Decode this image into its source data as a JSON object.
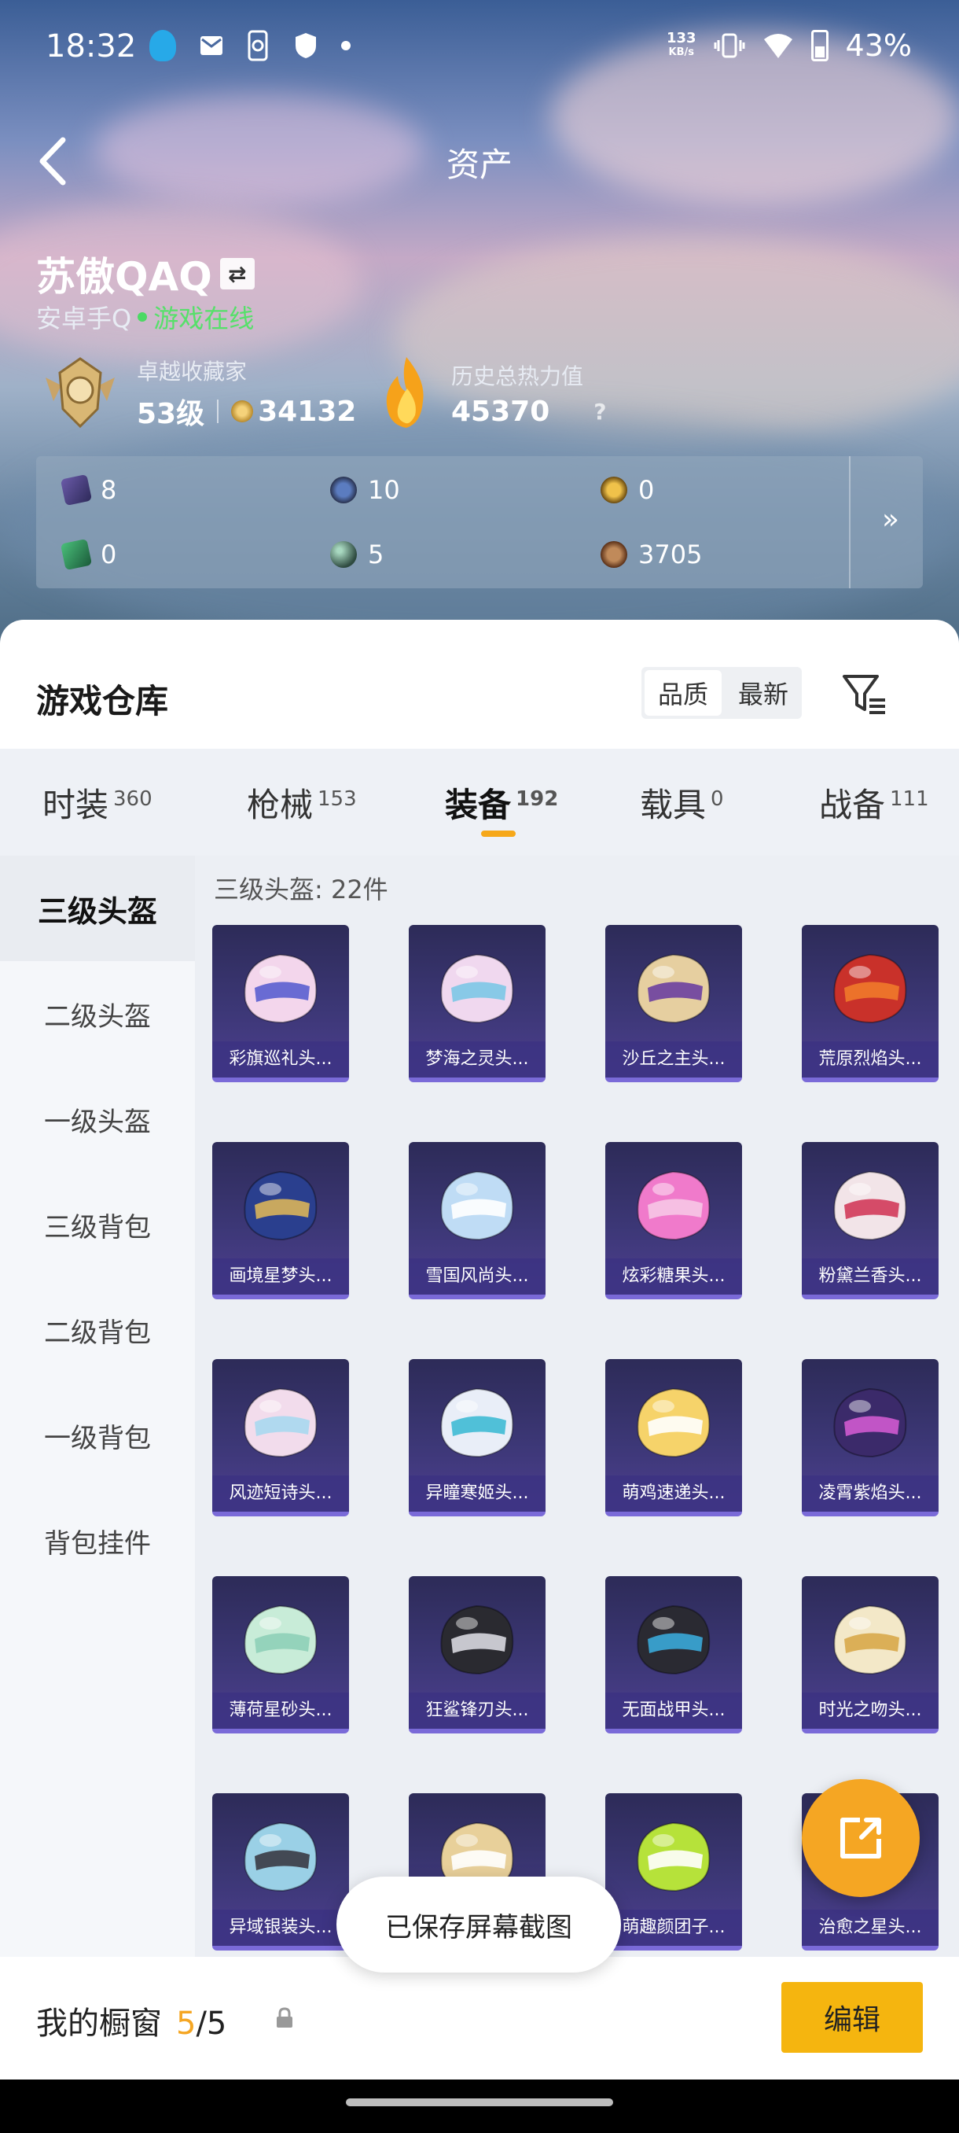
{
  "status_bar": {
    "time": "18:32",
    "speed": "133",
    "speed_unit": "KB/s",
    "battery": "43%"
  },
  "header": {
    "title": "资产"
  },
  "profile": {
    "name": "苏傲QAQ",
    "platform": "安卓手Q",
    "online_status": "游戏在线",
    "collector": {
      "label": "卓越收藏家",
      "level": "53级",
      "points": "34132"
    },
    "heat": {
      "label": "历史总热力值",
      "value": "45370",
      "help": "?"
    }
  },
  "stats": [
    {
      "icon": "card-icon",
      "value": "8"
    },
    {
      "icon": "s-coin-icon",
      "value": "10"
    },
    {
      "icon": "a-coin-icon",
      "value": "0"
    },
    {
      "icon": "green-card-icon",
      "value": "0"
    },
    {
      "icon": "orb-icon",
      "value": "5"
    },
    {
      "icon": "bronze-coin-icon",
      "value": "3705"
    }
  ],
  "stats_more": "»",
  "warehouse": {
    "title": "游戏仓库",
    "sort_options": [
      "品质",
      "最新"
    ],
    "active_sort": "品质"
  },
  "tabs": [
    {
      "label": "时装",
      "count": "360"
    },
    {
      "label": "枪械",
      "count": "153"
    },
    {
      "label": "装备",
      "count": "192"
    },
    {
      "label": "载具",
      "count": "0"
    },
    {
      "label": "战备",
      "count": "111"
    }
  ],
  "active_tab": "装备",
  "sidebar": [
    {
      "label": "三级头盔"
    },
    {
      "label": "二级头盔"
    },
    {
      "label": "一级头盔"
    },
    {
      "label": "三级背包"
    },
    {
      "label": "二级背包"
    },
    {
      "label": "一级背包"
    },
    {
      "label": "背包挂件"
    }
  ],
  "section": {
    "label": "三级头盔: 22件"
  },
  "items": [
    {
      "name": "彩旗巡礼头...",
      "c1": "#f3d6ec",
      "c2": "#5a5fd0"
    },
    {
      "name": "梦海之灵头...",
      "c1": "#f0d8ef",
      "c2": "#7cc8e6"
    },
    {
      "name": "沙丘之主头...",
      "c1": "#e6cfa0",
      "c2": "#6b3fa0"
    },
    {
      "name": "荒原烈焰头...",
      "c1": "#c9312a",
      "c2": "#f07a2a"
    },
    {
      "name": "画境星梦头...",
      "c1": "#2a3f8e",
      "c2": "#d9b45a"
    },
    {
      "name": "雪国风尚头...",
      "c1": "#bfdcf5",
      "c2": "#ffffff"
    },
    {
      "name": "炫彩糖果头...",
      "c1": "#f07acb",
      "c2": "#f6c6e6"
    },
    {
      "name": "粉黛兰香头...",
      "c1": "#f2e4e8",
      "c2": "#d23a5a"
    },
    {
      "name": "风迹短诗头...",
      "c1": "#f2dcec",
      "c2": "#a8d8f0"
    },
    {
      "name": "异瞳寒姬头...",
      "c1": "#e9eef8",
      "c2": "#3fbad4"
    },
    {
      "name": "萌鸡速递头...",
      "c1": "#f6d36a",
      "c2": "#ffffff"
    },
    {
      "name": "凌霄紫焰头...",
      "c1": "#3b2a6a",
      "c2": "#d05ad0"
    },
    {
      "name": "薄荷星砂头...",
      "c1": "#c8ecd8",
      "c2": "#8ed0b8"
    },
    {
      "name": "狂鲨锋刃头...",
      "c1": "#2a2a30",
      "c2": "#d8d8e0"
    },
    {
      "name": "无面战甲头...",
      "c1": "#2a2a32",
      "c2": "#3aa8d8"
    },
    {
      "name": "时光之吻头...",
      "c1": "#f3e8c8",
      "c2": "#d8a84a"
    },
    {
      "name": "异域银装头...",
      "c1": "#9ad0e6",
      "c2": "#3a3a44"
    },
    {
      "name": "",
      "c1": "#e8d09a",
      "c2": "#ffffff"
    },
    {
      "name": "萌趣颜团子...",
      "c1": "#b6e23a",
      "c2": "#ffffff"
    },
    {
      "name": "治愈之星头...",
      "c1": "#e6d0f0",
      "c2": "#ffffff"
    }
  ],
  "toast": "已保存屏幕截图",
  "showcase": {
    "label": "我的橱窗",
    "current": "5",
    "total": "/5",
    "edit": "编辑"
  }
}
